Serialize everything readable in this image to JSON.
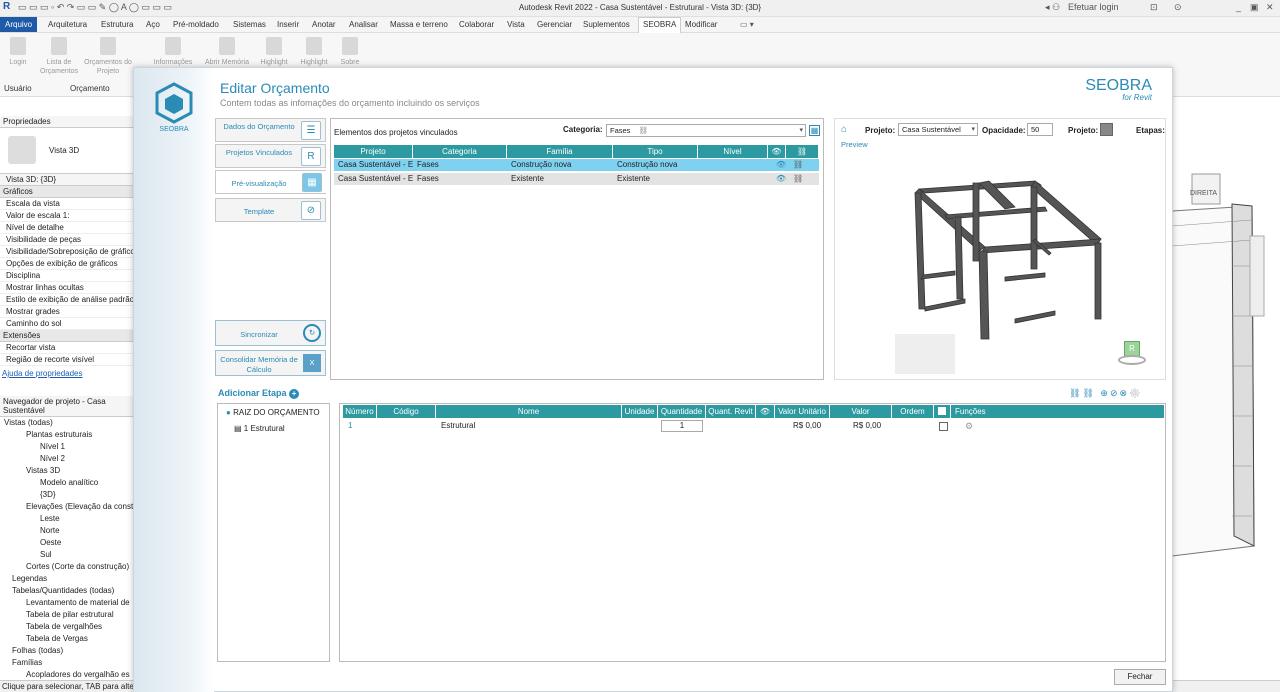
{
  "window_title": "Autodesk Revit 2022 - Casa Sustentável - Estrutural - Vista 3D: {3D}",
  "title_right": {
    "login": "Efetuar login",
    "help": "?"
  },
  "menu": [
    "Arquivo",
    "Arquitetura",
    "Estrutura",
    "Aço",
    "Pré-moldado",
    "Sistemas",
    "Inserir",
    "Anotar",
    "Analisar",
    "Massa e terreno",
    "Colaborar",
    "Vista",
    "Gerenciar",
    "Suplementos",
    "SEOBRA",
    "Modificar"
  ],
  "ribbon": {
    "buttons": [
      "Login",
      "Lista de Orçamentos",
      "Orçamentos do Projeto",
      "Informações",
      "Abrir Memória",
      "Highlight",
      "Highlight",
      "Sobre"
    ],
    "groups": [
      "Usuário",
      "Orçamento"
    ]
  },
  "properties": {
    "header": "Propriedades",
    "type": "Vista 3D",
    "view_selector": "Vista 3D: {3D}",
    "section_graphics": "Gráficos",
    "rows": [
      "Escala da vista",
      "Valor de escala    1:",
      "Nível de detalhe",
      "Visibilidade de peças",
      "Visibilidade/Sobreposição de gráficos",
      "Opções de exibição de gráficos",
      "Disciplina",
      "Mostrar linhas ocultas",
      "Estilo de exibição de análise padrão",
      "Mostrar grades",
      "Caminho do sol"
    ],
    "section_ext": "Extensões",
    "rows2": [
      "Recortar vista",
      "Região de recorte visível"
    ],
    "help_link": "Ajuda de propriedades"
  },
  "browser": {
    "header": "Navegador de projeto - Casa Sustentável",
    "items": [
      "Vistas (todas)",
      "Plantas estruturais",
      "Nível 1",
      "Nível 2",
      "Vistas 3D",
      "Modelo analítico",
      "{3D}",
      "Elevações (Elevação da construção)",
      "Leste",
      "Norte",
      "Oeste",
      "Sul",
      "Cortes (Corte da construção)",
      "Legendas",
      "Tabelas/Quantidades (todas)",
      "Levantamento de material de",
      "Tabela de pilar estrutural",
      "Tabela de vergalhões",
      "Tabela de Vergas",
      "Folhas (todas)",
      "Famílias",
      "Acopladores do vergalhão es"
    ]
  },
  "status": "Clique para selecionar, TAB para alternar",
  "viewcube_label": "DIREITA",
  "dialog": {
    "title": "Editar Orçamento",
    "subtitle": "Contem todas as infomações do orçamento incluindo os serviços",
    "brand": "SEOBRA",
    "brand_sub": "for Revit",
    "logo_text": "SEOBRA",
    "tabs": [
      "Dados do Orçamento",
      "Projetos Vinculados",
      "Pré-visualização",
      "Template"
    ],
    "sync_label": "Sincronizar",
    "consolidate_label": "Consolidar Memória de Cálculo",
    "linked": {
      "title": "Elementos dos projetos vinculados",
      "category_label": "Categoria:",
      "category_value": "Fases",
      "headers": [
        "Projeto",
        "Categoria",
        "Família",
        "Tipo",
        "Nível"
      ],
      "rows": [
        {
          "projeto": "Casa Sustentável - Es",
          "categoria": "Fases",
          "familia": "Construção nova",
          "tipo": "Construção nova",
          "nivel": ""
        },
        {
          "projeto": "Casa Sustentável - Es",
          "categoria": "Fases",
          "familia": "Existente",
          "tipo": "Existente",
          "nivel": ""
        }
      ]
    },
    "preview": {
      "projeto_label": "Projeto:",
      "projeto_value": "Casa Sustentável",
      "opacidade_label": "Opacidade:",
      "opacidade_value": "50",
      "projeto2_label": "Projeto:",
      "etapas_label": "Etapas:",
      "preview_label": "Preview"
    },
    "stage": {
      "add_label": "Adicionar Etapa",
      "tree_root": "RAIZ DO ORÇAMENTO",
      "tree_child": "1 Estrutural",
      "headers": [
        "Número",
        "Código",
        "Nome",
        "Unidade",
        "Quantidade",
        "Quant. Revit",
        "",
        "Valor Unitário",
        "Valor",
        "Ordem",
        "",
        "Funções"
      ],
      "row": {
        "numero": "1",
        "codigo": "",
        "nome": "Estrutural",
        "unidade": "",
        "quantidade": "1",
        "quant_revit": "",
        "valor_unitario": "R$ 0,00",
        "valor": "R$ 0,00",
        "ordem": ""
      }
    },
    "close_label": "Fechar"
  }
}
